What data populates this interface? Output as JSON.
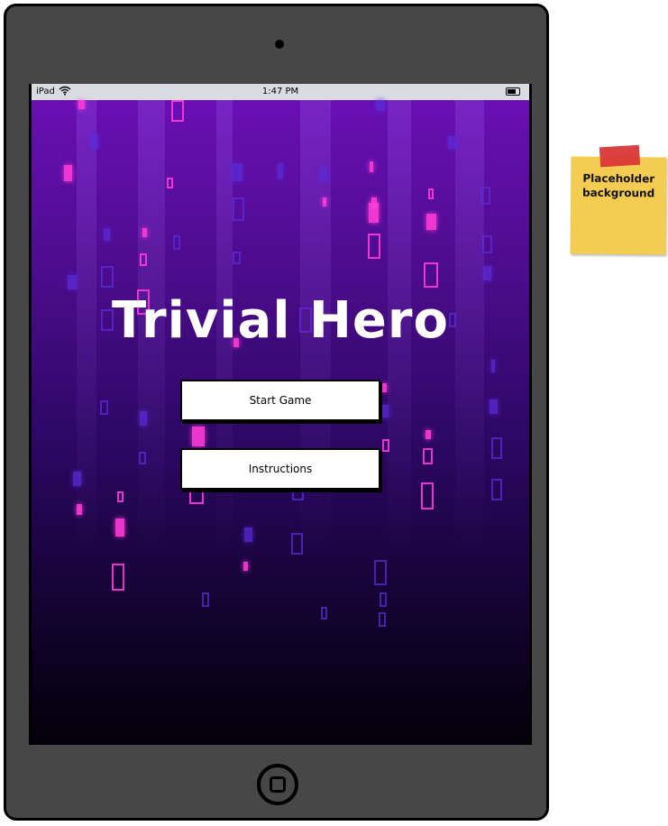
{
  "device": {
    "status_bar": {
      "carrier": "iPad",
      "time": "1:47 PM"
    }
  },
  "app": {
    "title": "Trivial Hero",
    "buttons": {
      "start_game": "Start Game",
      "instructions": "Instructions"
    }
  },
  "annotation": {
    "note_line1": "Placeholder",
    "note_line2": "background"
  },
  "colors": {
    "bg_top": "#6a0fb4",
    "bg_bottom": "#030009",
    "accent_pink": "#ff3bd8",
    "accent_violet": "#5b2bd8",
    "note_yellow": "#f5cc52",
    "tape_red": "#d93737",
    "device_frame": "#474747"
  },
  "icons": [
    "wifi-icon",
    "battery-icon",
    "home-button-icon",
    "camera-icon"
  ]
}
